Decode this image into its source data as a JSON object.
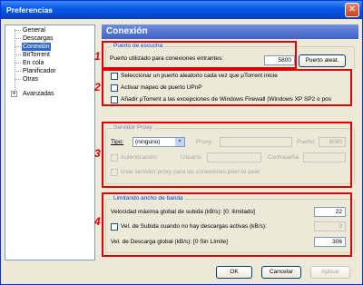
{
  "window": {
    "title": "Preferencias",
    "close_glyph": "✕"
  },
  "tree": {
    "items": [
      "General",
      "Descargas",
      "Conexión",
      "BitTorrent",
      "En cola",
      "Planificador",
      "Otras",
      "Avanzadas"
    ],
    "selected": "Conexión",
    "expander_glyph": "+"
  },
  "header": {
    "title": "Conexión"
  },
  "port_group": {
    "title": "Puerto de escucha",
    "port_label": "Puerto utilizado para conexiones entrantes:",
    "port_value": "5800",
    "random_button": "Puerto aleat."
  },
  "options": [
    "Seleccionar un puerto aleatorio cada vez que µTorrent inicie",
    "Activar mapeo de puerto UPnP",
    "Añadir µTorrent a las excepciones de Windows Firewall (Windows XP SP2 o pos"
  ],
  "proxy_group": {
    "title": "Servidor Proxy",
    "type_label": "Tipo:",
    "type_value": "(ninguno)",
    "proxy_label": "Proxy:",
    "port_label": "Puerto:",
    "port_value": "8080",
    "auth_label": "Autenticación:",
    "user_label": "Usuario:",
    "password_label": "Contraseña:",
    "peer_label": "Usar servidor proxy para las conexiones peer-to-peer"
  },
  "bandwidth_group": {
    "title": "Limitando ancho de banda",
    "upload_label": "Velocidad máxima global de subida (kB/s): [0: ilimitado]",
    "upload_value": "22",
    "alt_upload_label": "Vel. de Subida cuando no hay descargas activas (kB/s):",
    "alt_upload_value": "0",
    "download_label": "Vel. de Descarga global (kB/s): [0 Sin Límite]",
    "download_value": "306"
  },
  "footer": {
    "ok": "OK",
    "cancel": "Cancelar",
    "apply": "Aplicar"
  },
  "annotations": [
    "1",
    "2",
    "3",
    "4"
  ],
  "colors": {
    "annotation": "#e00000",
    "header": "#3e62c8",
    "title_bar": "#0a5ae5"
  }
}
